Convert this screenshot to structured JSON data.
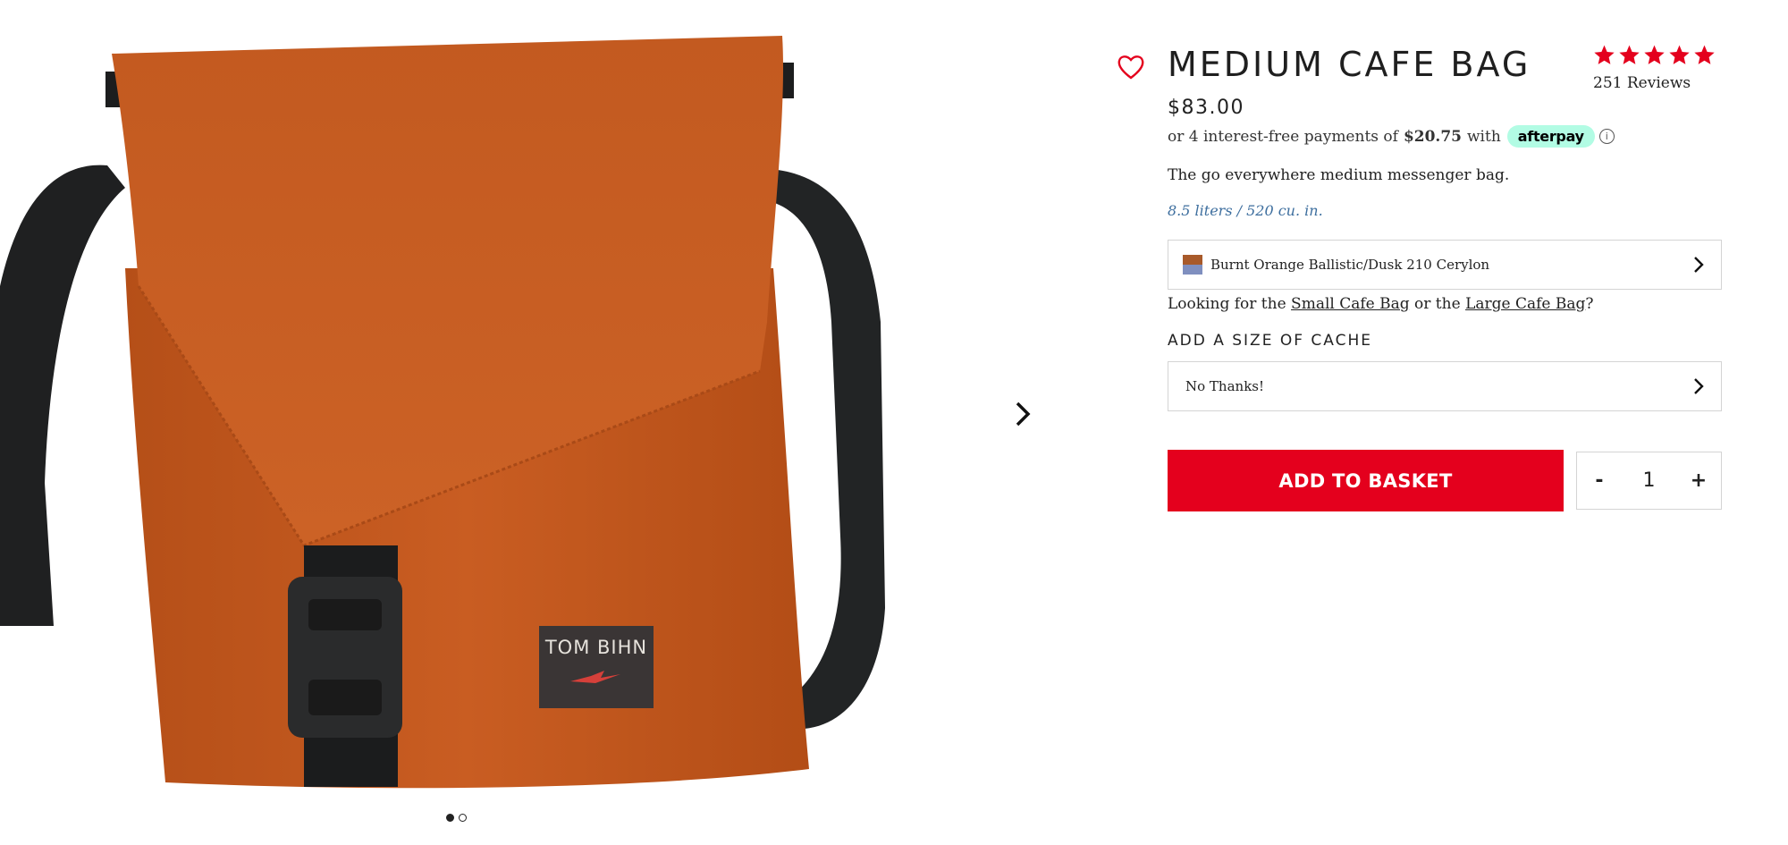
{
  "product": {
    "title": "MEDIUM CAFE BAG",
    "price": "$83.00",
    "rating": 5,
    "reviews_label": "251 Reviews",
    "description": "The go everywhere medium messenger bag.",
    "capacity": "8.5 liters / 520 cu. in.",
    "patch_text": "TOM BIHN"
  },
  "afterpay": {
    "prefix": "or 4 interest-free payments of",
    "amount": "$20.75",
    "suffix": "with",
    "badge": "afterpay",
    "info_icon": "ⓘ"
  },
  "color_select": {
    "selected": "Burnt Orange Ballistic/Dusk 210 Cerylon",
    "swatch_colors": [
      "#a85a2a",
      "#7f8fbf"
    ]
  },
  "looking_for": {
    "prefix": "Looking for the",
    "link1": "Small Cafe Bag",
    "middle": "or the",
    "link2": "Large Cafe Bag",
    "suffix": "?"
  },
  "cache": {
    "heading": "ADD A SIZE OF CACHE",
    "selected": "No Thanks!"
  },
  "cart": {
    "add_label": "ADD TO BASKET",
    "minus_label": "-",
    "plus_label": "+",
    "quantity": "1"
  },
  "gallery": {
    "slides": 2,
    "active_slide": 1
  },
  "colors": {
    "accent": "#e4001d",
    "link_blue": "#3d6e9e",
    "afterpay_mint": "#b2fce4",
    "bag_orange": "#c65a1e"
  }
}
